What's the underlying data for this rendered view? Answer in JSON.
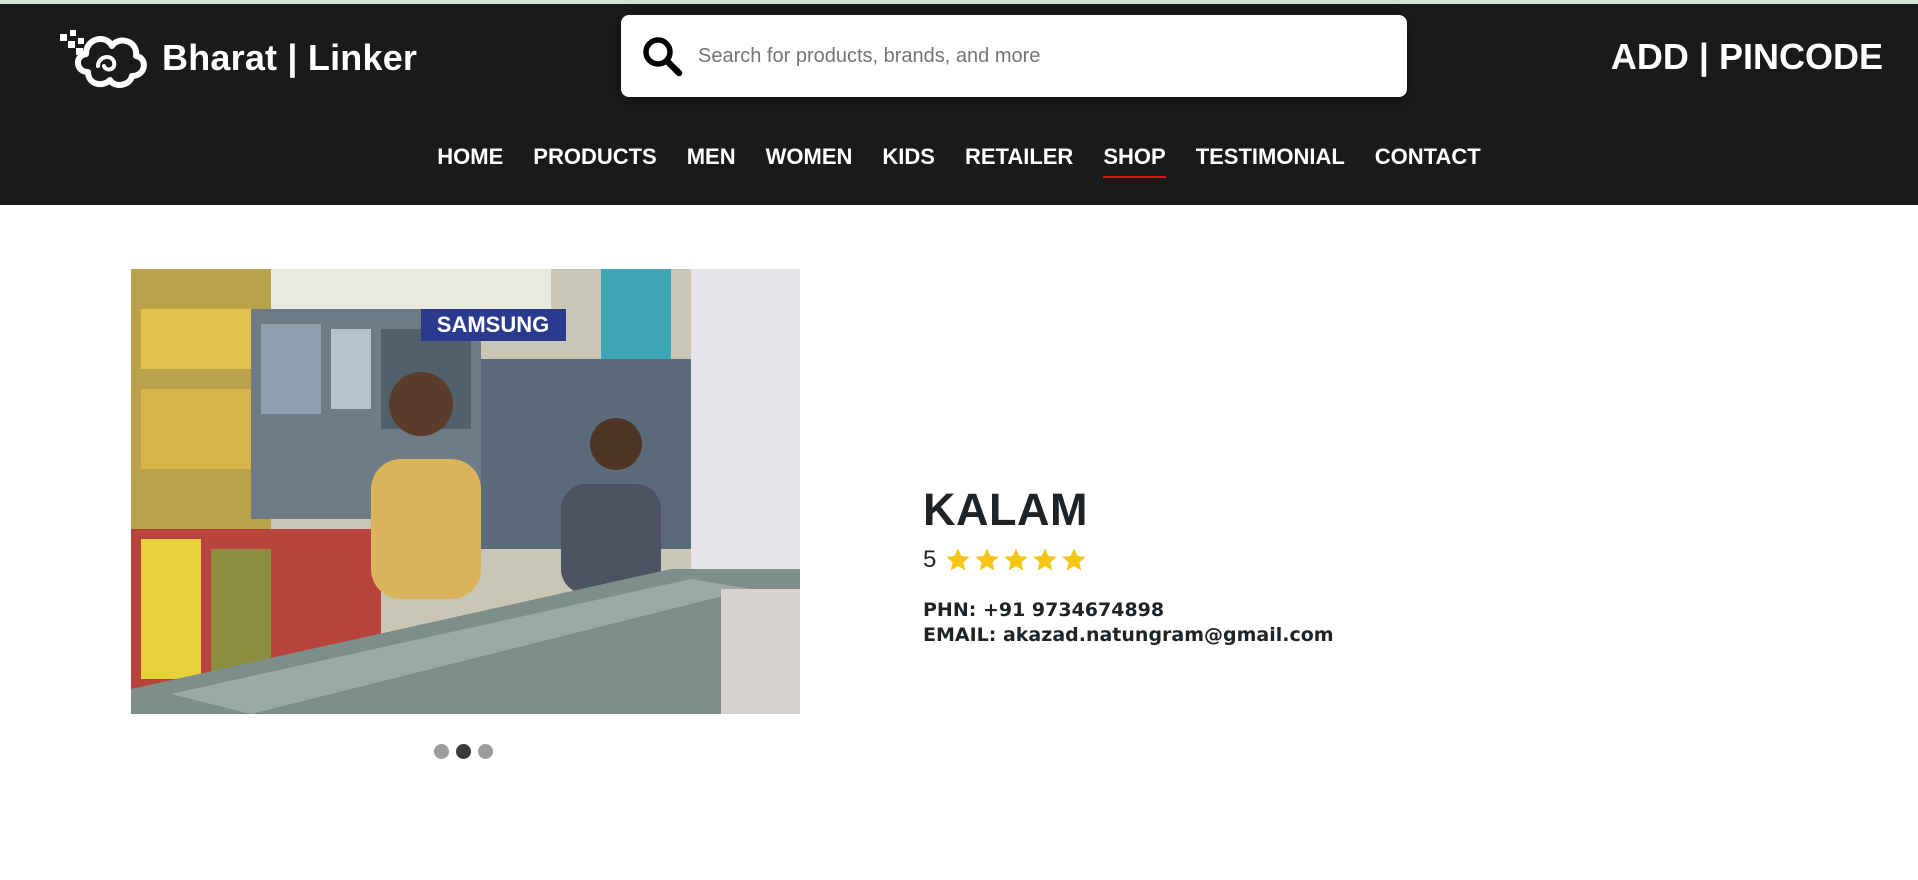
{
  "header": {
    "brand_name": "Bharat | Linker",
    "search_placeholder": "Search for products, brands, and more",
    "pincode_label": "ADD | PINCODE"
  },
  "nav": {
    "items": [
      {
        "label": "HOME"
      },
      {
        "label": "PRODUCTS"
      },
      {
        "label": "MEN"
      },
      {
        "label": "WOMEN"
      },
      {
        "label": "KIDS"
      },
      {
        "label": "RETAILER"
      },
      {
        "label": "SHOP",
        "active": true
      },
      {
        "label": "TESTIMONIAL"
      },
      {
        "label": "CONTACT"
      }
    ]
  },
  "shop": {
    "name": "KALAM",
    "rating": "5",
    "stars": 5,
    "phone": "PHN: +91 9734674898",
    "email": "EMAIL: akazad.natungram@gmail.com",
    "image_sign": "SAMSUNG",
    "image_alt": "Shop photo: two men at a mobile phone store counter"
  },
  "carousel": {
    "slides": 3,
    "active_index": 1
  },
  "colors": {
    "header_bg": "#1b1a1a",
    "active_underline": "#e01010",
    "star": "#f5c518",
    "text_dark": "#1f2326"
  },
  "icons": {
    "search": "search-icon",
    "logo": "cloud-logo-icon",
    "star": "star-icon"
  }
}
